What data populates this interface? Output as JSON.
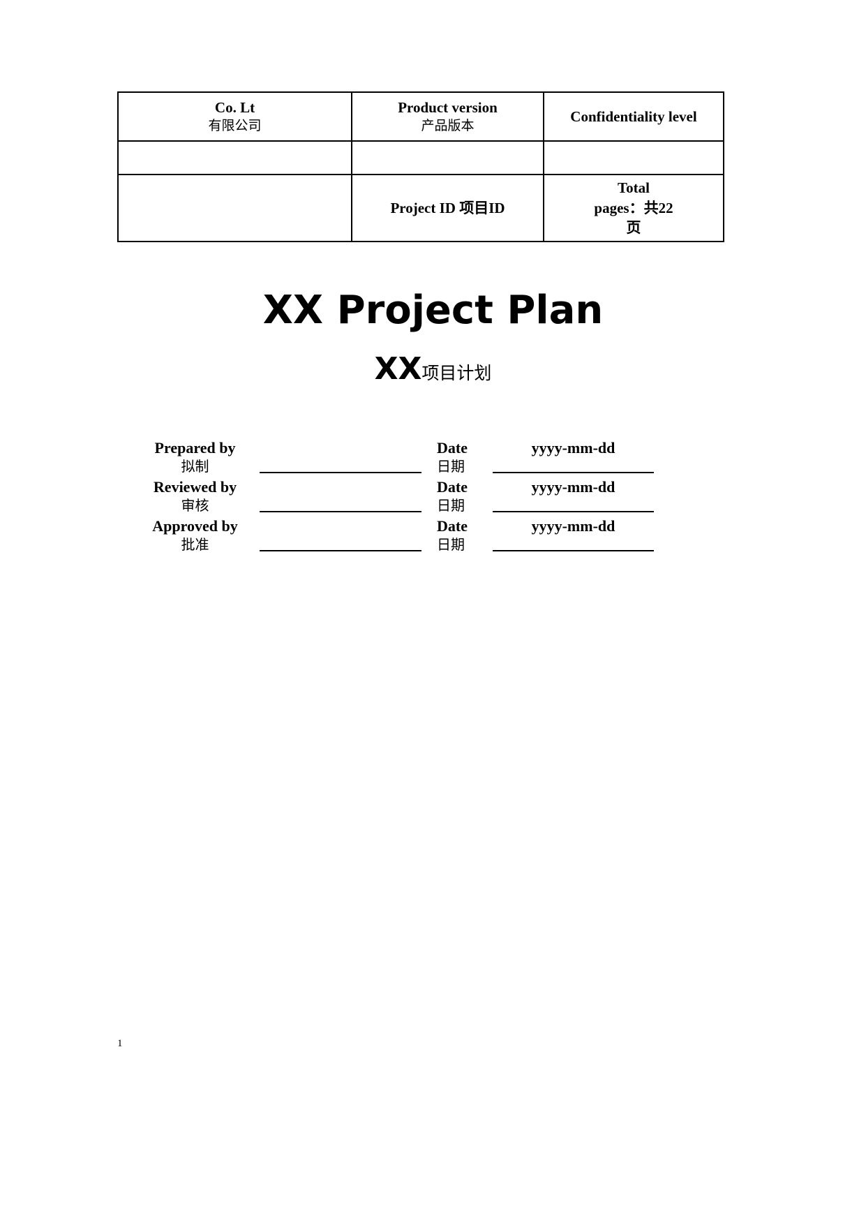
{
  "document": {
    "title_en": "XX Project Plan",
    "subtitle_xx": "XX",
    "subtitle_cn": "项目计划",
    "page_number": "1"
  },
  "header_table": {
    "row1": {
      "company_en": "Co. Lt",
      "company_cn": "有限公司",
      "product_version_en": "Product version",
      "product_version_cn": "产品版本",
      "confidentiality_en": "Confidentiality level"
    },
    "row2": {
      "company_value": "",
      "product_version_value": "",
      "confidentiality_value": ""
    },
    "row3": {
      "blank_value": "",
      "project_id_label": "Project ID 项目ID",
      "total_pages_line1": "Total",
      "total_pages_line2": "pages：共22",
      "total_pages_line3": "页"
    }
  },
  "signatures": {
    "rows": [
      {
        "label_en": "Prepared by",
        "label_cn": "拟制",
        "signature_value": "",
        "date_label_en": "Date",
        "date_label_cn": "日期",
        "date_value": "yyyy-mm-dd"
      },
      {
        "label_en": "Reviewed by",
        "label_cn": "审核",
        "signature_value": "",
        "date_label_en": "Date",
        "date_label_cn": "日期",
        "date_value": "yyyy-mm-dd"
      },
      {
        "label_en": "Approved by",
        "label_cn": "批准",
        "signature_value": "",
        "date_label_en": "Date",
        "date_label_cn": "日期",
        "date_value": "yyyy-mm-dd"
      }
    ]
  }
}
